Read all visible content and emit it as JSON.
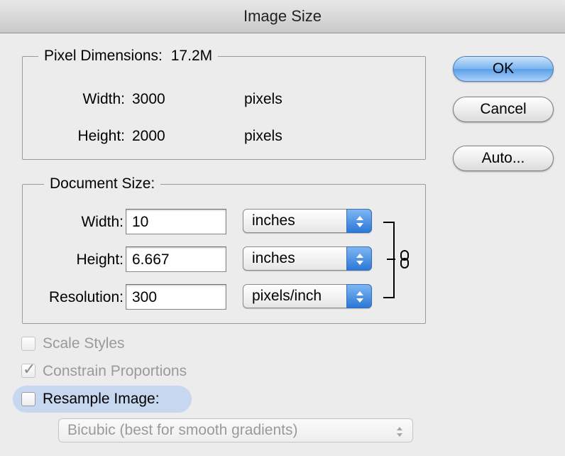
{
  "window": {
    "title": "Image Size"
  },
  "pixel_dimensions": {
    "legend": "Pixel Dimensions:",
    "size": "17.2M",
    "width_label": "Width:",
    "width_value": "3000",
    "width_unit": "pixels",
    "height_label": "Height:",
    "height_value": "2000",
    "height_unit": "pixels"
  },
  "document_size": {
    "legend": "Document Size:",
    "width_label": "Width:",
    "width_value": "10",
    "width_unit": "inches",
    "height_label": "Height:",
    "height_value": "6.667",
    "height_unit": "inches",
    "resolution_label": "Resolution:",
    "resolution_value": "300",
    "resolution_unit": "pixels/inch"
  },
  "buttons": {
    "ok": "OK",
    "cancel": "Cancel",
    "auto": "Auto..."
  },
  "options": {
    "scale_styles": {
      "label": "Scale Styles",
      "checked": false,
      "enabled": false
    },
    "constrain_proportions": {
      "label": "Constrain Proportions",
      "checked": true,
      "enabled": false
    },
    "resample_image": {
      "label": "Resample Image:",
      "checked": false,
      "enabled": true
    }
  },
  "resample_method": {
    "value": "Bicubic (best for smooth gradients)",
    "enabled": false
  },
  "colors": {
    "accent": "#5a9ee6",
    "disabled_text": "#9a9a9a",
    "highlight": "#c7d7ef"
  },
  "icons": {
    "link": "chain-link-icon",
    "popup_arrows": "up-down-arrows-icon"
  }
}
